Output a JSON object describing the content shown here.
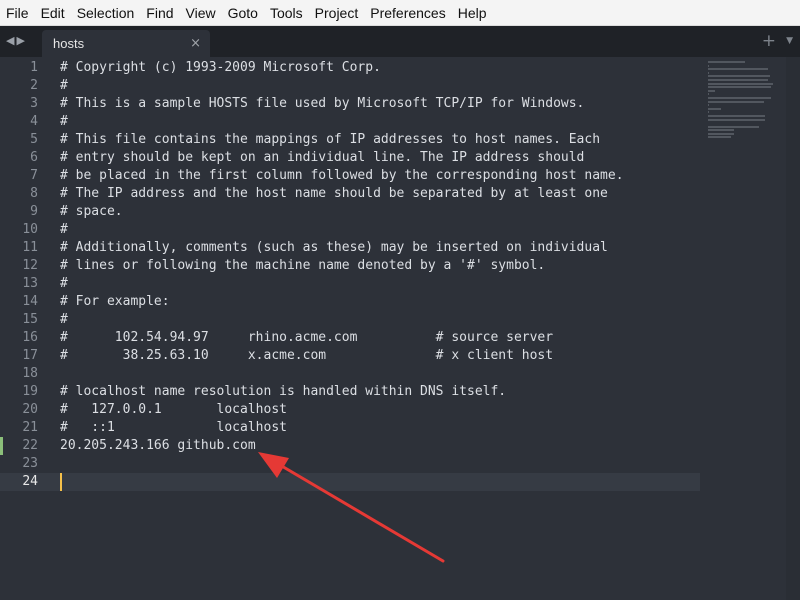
{
  "menu": {
    "items": [
      "File",
      "Edit",
      "Selection",
      "Find",
      "View",
      "Goto",
      "Tools",
      "Project",
      "Preferences",
      "Help"
    ]
  },
  "tabs": {
    "nav_left": "◀",
    "nav_right": "▶",
    "active": {
      "label": "hosts",
      "close": "×"
    },
    "add": "+",
    "menu": "▼"
  },
  "editor": {
    "current_line": 24,
    "modified_line": 22,
    "lines": [
      "# Copyright (c) 1993-2009 Microsoft Corp.",
      "#",
      "# This is a sample HOSTS file used by Microsoft TCP/IP for Windows.",
      "#",
      "# This file contains the mappings of IP addresses to host names. Each",
      "# entry should be kept on an individual line. The IP address should",
      "# be placed in the first column followed by the corresponding host name.",
      "# The IP address and the host name should be separated by at least one",
      "# space.",
      "#",
      "# Additionally, comments (such as these) may be inserted on individual",
      "# lines or following the machine name denoted by a '#' symbol.",
      "#",
      "# For example:",
      "#",
      "#      102.54.94.97     rhino.acme.com          # source server",
      "#       38.25.63.10     x.acme.com              # x client host",
      "",
      "# localhost name resolution is handled within DNS itself.",
      "#   127.0.0.1       localhost",
      "#   ::1             localhost",
      "20.205.243.166 github.com",
      "",
      ""
    ]
  },
  "colors": {
    "background": "#2d3139",
    "text": "#dcdfe4",
    "gutter_text": "#8a9099",
    "caret": "#f5c04a",
    "annotation_arrow": "#e53935"
  }
}
